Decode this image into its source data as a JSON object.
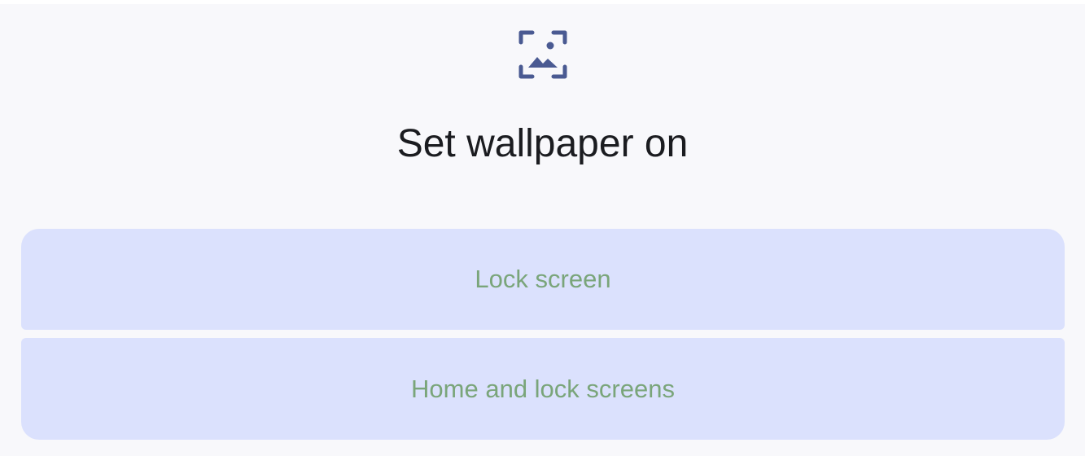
{
  "dialog": {
    "icon": "wallpaper-icon",
    "title": "Set wallpaper on",
    "options": [
      {
        "label": "Lock screen"
      },
      {
        "label": "Home and lock screens"
      }
    ]
  },
  "colors": {
    "icon": "#4a5a92",
    "button_bg": "#dbe1fd",
    "button_text": "#7aa57a",
    "title_text": "#1b1c20",
    "sheet_bg": "#f8f8fb"
  }
}
